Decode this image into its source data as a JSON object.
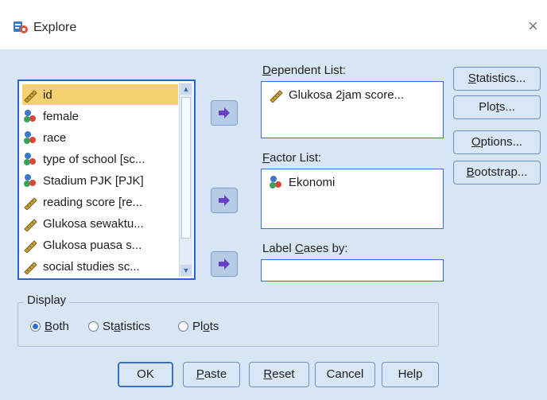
{
  "window": {
    "title": "Explore",
    "close_glyph": "×",
    "icon": "spss-explore-icon"
  },
  "variables": [
    {
      "label": "id",
      "type": "scale",
      "selected": true
    },
    {
      "label": "female",
      "type": "nominal",
      "selected": false
    },
    {
      "label": "race",
      "type": "nominal",
      "selected": false
    },
    {
      "label": "type of school [sc...",
      "type": "nominal",
      "selected": false
    },
    {
      "label": "Stadium PJK [PJK]",
      "type": "nominal",
      "selected": false
    },
    {
      "label": "reading score [re...",
      "type": "scale",
      "selected": false
    },
    {
      "label": "Glukosa sewaktu...",
      "type": "scale",
      "selected": false
    },
    {
      "label": "Glukosa puasa s...",
      "type": "scale",
      "selected": false
    },
    {
      "label": "social studies sc...",
      "type": "scale",
      "selected": false
    }
  ],
  "dependent_list": {
    "label_u": "D",
    "label_rest": "ependent List:",
    "items": [
      "Glukosa 2jam score..."
    ]
  },
  "factor_list": {
    "label_u": "F",
    "label_rest": "actor List:",
    "items": [
      "Ekonomi"
    ]
  },
  "label_cases": {
    "label_pre": "Label ",
    "label_u": "C",
    "label_rest": "ases by:",
    "value": ""
  },
  "side_buttons": {
    "statistics": {
      "u": "S",
      "rest": "tatistics..."
    },
    "plots": {
      "pre": "Plo",
      "u": "t",
      "rest": "s..."
    },
    "options": {
      "u": "O",
      "rest": "ptions..."
    },
    "bootstrap": {
      "u": "B",
      "rest": "ootstrap..."
    }
  },
  "display": {
    "legend": "Display",
    "options": [
      {
        "pre": "",
        "u": "B",
        "rest": "oth",
        "checked": true
      },
      {
        "pre": "St",
        "u": "a",
        "rest": "tistics",
        "checked": false
      },
      {
        "pre": "Pl",
        "u": "o",
        "rest": "ts",
        "checked": false
      }
    ]
  },
  "bottom_buttons": {
    "ok": {
      "u": "",
      "rest": "OK"
    },
    "paste": {
      "u": "P",
      "rest": "aste"
    },
    "reset": {
      "u": "R",
      "rest": "eset"
    },
    "cancel": {
      "u": "",
      "rest": "Cancel"
    },
    "help": {
      "u": "",
      "rest": "Help"
    }
  },
  "colors": {
    "dialog_bg": "#d8e6f4",
    "selection": "#f4d06f",
    "accent": "#2b63c8"
  }
}
